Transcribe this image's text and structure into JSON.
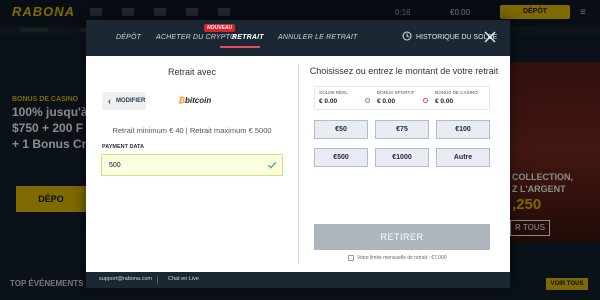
{
  "site": {
    "logo": "RABONA",
    "time": "0:16",
    "balance": "€0.00",
    "deposit_label": "DÉPÔT",
    "promo": {
      "tag": "BONUS DE CASINO",
      "line1": "100% jusqu'à",
      "line2": "$750 + 200 F",
      "line3": "+ 1 Bonus Cr",
      "cta": "DÉPO"
    },
    "right_promo": {
      "line1": "COLLECTION,",
      "line2": "Z L'ARGENT",
      "amount": ",250",
      "cta": "R TOUS"
    },
    "top_events": "TOP ÉVÉNEMENTS",
    "voir_tous": "VOIR TOUS"
  },
  "modal": {
    "tabs": [
      {
        "label": "DÉPÔT"
      },
      {
        "label": "ACHETER DU CRYPTO"
      },
      {
        "label": "RETRAIT"
      },
      {
        "label": "ANNULER LE RETRAIT"
      }
    ],
    "new_badge": "NOUVEAU",
    "history_label": "HISTORIQUE DU SOLDE",
    "left": {
      "title": "Retrait avec",
      "back_label": "MODIFIER",
      "method_name": "bitcoin",
      "method_letter": "₿",
      "limits": "Retrait minimum € 40 | Retrait maximum € 5000",
      "payment_label": "PAYMENT DATA",
      "payment_value": "500"
    },
    "right": {
      "title": "Choisissez ou entrez le montant de votre retrait",
      "balances": [
        {
          "label": "SOLDE RÉEL",
          "value": "€ 0.00"
        },
        {
          "label": "BONUS SPORTIF",
          "value": "€ 0.00"
        },
        {
          "label": "BONUS DE CASINO",
          "value": "€ 0.00"
        }
      ],
      "amounts": [
        "€50",
        "€75",
        "€100",
        "€500",
        "€1000",
        "Autre"
      ],
      "submit_label": "RETIRER",
      "monthly_limit": "Votre limite mensuelle de retrait : €7,000"
    },
    "footer": {
      "email": "support@rabona.com",
      "chat": "Chat en Live"
    }
  }
}
